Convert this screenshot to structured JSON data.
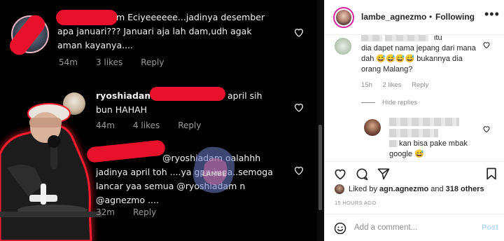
{
  "screenshot": {
    "comment1": {
      "text_line1": "m Eciyeeeeee...jadinya desember",
      "text_line2": "apa januari??? Januari aja lah dam,udh agak",
      "text_line3": "aman kayanya....",
      "time": "54m",
      "likes": "3 likes",
      "reply": "Reply"
    },
    "comment2": {
      "username": "ryoshiadam",
      "text_line1_tail": "april sih",
      "text_line2": "bun HAHAH",
      "time": "44m",
      "likes": "4 likes",
      "reply": "Reply"
    },
    "comment3": {
      "text_line1": "@ryoshiadam oalahhh",
      "text_line2": "jadinya april toh ....ya gpp juga..semoga",
      "text_line3": "lancar yaa semua @ryoshiadam n",
      "text_line4": "@agnezmo ....",
      "time": "32m",
      "reply": "Reply"
    },
    "watermark": "LAMBE"
  },
  "header": {
    "username": "lambe_agnezmo",
    "separator": "•",
    "follow_status": "Following",
    "more_icon": "more-horizontal-icon"
  },
  "comments": [
    {
      "line1": "itu",
      "line2": "dia dapet nama jepang dari mana",
      "line3": "dah 😅😅😅😅 bukannya dia",
      "line4": "orang Malang?",
      "time": "15h",
      "likes": "2 likes",
      "reply": "Reply"
    },
    {
      "hide_replies": "Hide replies"
    },
    {
      "line1": "kan bisa pake mbak",
      "line2": "google 😅"
    }
  ],
  "likes": {
    "prefix": "Liked by",
    "user": "agn.agnezmo",
    "joiner": "and",
    "others": "318 others"
  },
  "time_ago": "15 HOURS AGO",
  "add_comment": {
    "placeholder": "Add a comment...",
    "post_label": "Post"
  },
  "colors": {
    "redaction": "#e8112b",
    "post_button": "#b3dbff",
    "muted_text": "#8e8e8e"
  }
}
